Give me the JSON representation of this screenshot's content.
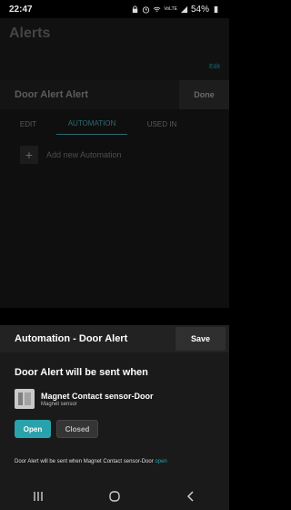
{
  "status": {
    "time": "22:47",
    "battery": "54%",
    "signal_text": "VoLTE"
  },
  "background": {
    "title": "Alerts",
    "edit_link": "Edit"
  },
  "alert_editor": {
    "title": "Door Alert Alert",
    "done_label": "Done",
    "tabs": [
      "EDIT",
      "AUTOMATION",
      "USED IN"
    ],
    "active_tab": "AUTOMATION",
    "add_label": "Add new Automation"
  },
  "automation_sheet": {
    "title": "Automation - Door Alert",
    "save_label": "Save",
    "heading": "Door Alert will be sent when",
    "device": {
      "name": "Magnet Contact sensor-Door",
      "type": "Magnet sensor"
    },
    "options": [
      "Open",
      "Closed"
    ],
    "selected_option": "Open",
    "summary_prefix": "Door Alert will be sent when Magnet Contact sensor-Door",
    "summary_value": "open"
  },
  "colors": {
    "accent": "#2aa2ac",
    "sheet_bg": "#1a1a1a",
    "overlay_bg": "#0f0f0f"
  },
  "navbar": {
    "icons": [
      "recents-icon",
      "home-icon",
      "back-icon"
    ]
  }
}
